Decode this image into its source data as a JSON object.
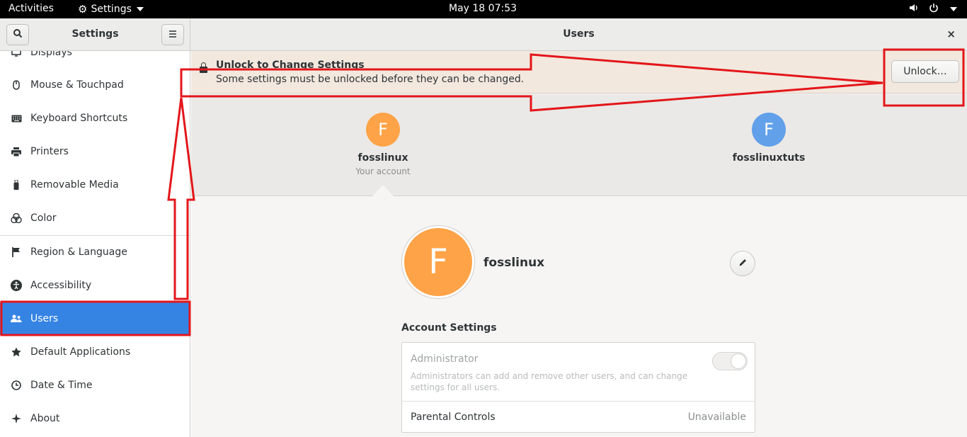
{
  "topbar": {
    "activities": "Activities",
    "app_name": "Settings",
    "clock": "May 18  07:53"
  },
  "header": {
    "sidebar_title": "Settings",
    "main_title": "Users",
    "close": "×"
  },
  "sidebar": {
    "partial_item": "Displays",
    "items": [
      {
        "label": "Mouse & Touchpad",
        "icon": "mouse-icon"
      },
      {
        "label": "Keyboard Shortcuts",
        "icon": "keyboard-icon"
      },
      {
        "label": "Printers",
        "icon": "printer-icon"
      },
      {
        "label": "Removable Media",
        "icon": "usb-icon"
      },
      {
        "label": "Color",
        "icon": "color-icon"
      },
      {
        "label": "Region & Language",
        "icon": "flag-icon"
      },
      {
        "label": "Accessibility",
        "icon": "accessibility-icon"
      },
      {
        "label": "Users",
        "icon": "users-icon",
        "active": true
      },
      {
        "label": "Default Applications",
        "icon": "star-icon"
      },
      {
        "label": "Date & Time",
        "icon": "clock-icon"
      },
      {
        "label": "About",
        "icon": "sparkle-icon"
      }
    ]
  },
  "infobar": {
    "title": "Unlock to Change Settings",
    "message": "Some settings must be unlocked before they can be changed.",
    "unlock_label": "Unlock…"
  },
  "users": [
    {
      "initial": "F",
      "name": "fosslinux",
      "subtitle": "Your account",
      "color": "#ffa348"
    },
    {
      "initial": "F",
      "name": "fosslinuxtuts",
      "subtitle": "",
      "color": "#62a0ea"
    }
  ],
  "selected_user": {
    "initial": "F",
    "name": "fosslinux"
  },
  "account_settings": {
    "heading": "Account Settings",
    "administrator_label": "Administrator",
    "administrator_desc": "Administrators can add and remove other users, and can change settings for all users.",
    "administrator_enabled": false,
    "parental_label": "Parental Controls",
    "parental_value": "Unavailable"
  },
  "colors": {
    "accent": "#3584e4",
    "annotation": "#e3161b"
  }
}
